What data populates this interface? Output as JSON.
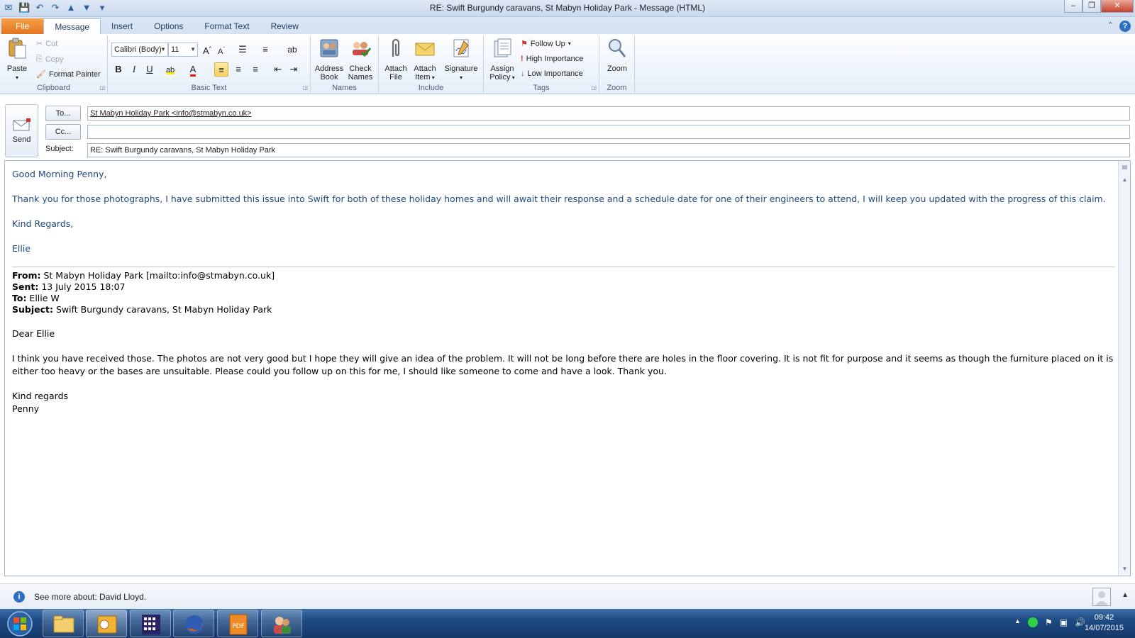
{
  "window": {
    "title": "RE: Swift Burgundy caravans, St Mabyn Holiday Park  -  Message (HTML)"
  },
  "ribbon": {
    "tabs": [
      "File",
      "Message",
      "Insert",
      "Options",
      "Format Text",
      "Review"
    ],
    "active_tab": "Message",
    "clipboard": {
      "label": "Clipboard",
      "paste": "Paste",
      "cut": "Cut",
      "copy": "Copy",
      "format_painter": "Format Painter"
    },
    "basic_text": {
      "label": "Basic Text",
      "font": "Calibri (Body)",
      "font_size": "11"
    },
    "names": {
      "label": "Names",
      "address_book": [
        "Address",
        "Book"
      ],
      "check_names": [
        "Check",
        "Names"
      ]
    },
    "include": {
      "label": "Include",
      "attach_file": [
        "Attach",
        "File"
      ],
      "attach_item": [
        "Attach",
        "Item"
      ],
      "signature": "Signature"
    },
    "tags": {
      "label": "Tags",
      "assign_policy": [
        "Assign",
        "Policy"
      ],
      "follow_up": "Follow Up",
      "high_importance": "High Importance",
      "low_importance": "Low Importance"
    },
    "zoom": {
      "label": "Zoom",
      "zoom": "Zoom"
    }
  },
  "header": {
    "send": "Send",
    "to_button": "To...",
    "cc_button": "Cc...",
    "subject_label": "Subject:",
    "to_value": "St Mabyn Holiday Park <info@stmabyn.co.uk>",
    "cc_value": "",
    "subject_value": "RE: Swift Burgundy caravans, St Mabyn Holiday Park"
  },
  "body": {
    "greeting": "Good Morning Penny,",
    "paragraph": "Thank you for those photographs, I have submitted this issue into Swift for both of these holiday homes and will await their response and a schedule date for one of their engineers to attend, I will keep you updated with the progress of this claim.",
    "closing": "Kind Regards,",
    "signature": "Ellie",
    "quoted": {
      "from_label": "From:",
      "from": " St Mabyn Holiday Park [mailto:info@stmabyn.co.uk]",
      "sent_label": "Sent:",
      "sent": " 13 July 2015 18:07",
      "to_label": "To:",
      "to": " Ellie W",
      "subject_label": "Subject:",
      "subject": " Swift Burgundy caravans, St Mabyn Holiday Park",
      "salutation": "Dear Ellie",
      "paragraph": "I think you have received those.  The photos are not very good but I hope they will give an idea of the problem.  It will not be long before there are holes in the floor covering.  It is not fit for purpose and it seems as though the furniture placed on it is either too heavy or the bases are unsuitable.  Please could you follow up on this for me, I should like someone to come and have a look.  Thank you.",
      "closing": "Kind regards",
      "name": "Penny"
    }
  },
  "people_pane": {
    "text": "See more about: David Lloyd."
  },
  "taskbar": {
    "time": "09:42",
    "date": "14/07/2015"
  },
  "colors": {
    "reply_text": "#1f497d",
    "file_tab": "#e2731f",
    "taskbar": "#1d4a82"
  }
}
